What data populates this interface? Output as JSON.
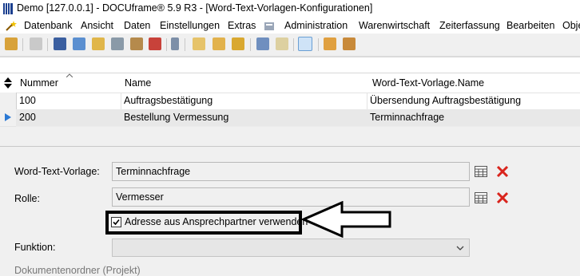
{
  "window": {
    "title": "Demo [127.0.0.1] - DOCUframe® 5.9 R3 - [Word-Text-Vorlagen-Konfigurationen]"
  },
  "menu": [
    "Datenbank",
    "Ansicht",
    "Daten",
    "Einstellungen",
    "Extras",
    "Administration",
    "Warenwirtschaft",
    "Zeiterfassung",
    "Bearbeiten",
    "Obje"
  ],
  "grid": {
    "columns": [
      "Nummer",
      "Name",
      "Word-Text-Vorlage.Name"
    ],
    "rows": [
      {
        "nummer": "100",
        "name": "Auftragsbestätigung",
        "vorlage": "Übersendung Auftragsbestätigung"
      },
      {
        "nummer": "200",
        "name": "Bestellung Vermessung",
        "vorlage": "Terminnachfrage"
      }
    ]
  },
  "form": {
    "vorlage_label": "Word-Text-Vorlage:",
    "vorlage_value": "Terminnachfrage",
    "rolle_label": "Rolle:",
    "rolle_value": "Vermesser",
    "checkbox_label": "Adresse aus Ansprechpartner verwenden",
    "checkbox_checked": true,
    "funktion_label": "Funktion:",
    "funktion_value": "",
    "dokumentenordner_label": "Dokumentenordner (Projekt)"
  },
  "colors": {
    "selection": "#e8e8e8",
    "clear_icon": "#d9241c",
    "row_pointer": "#2b79d4"
  }
}
